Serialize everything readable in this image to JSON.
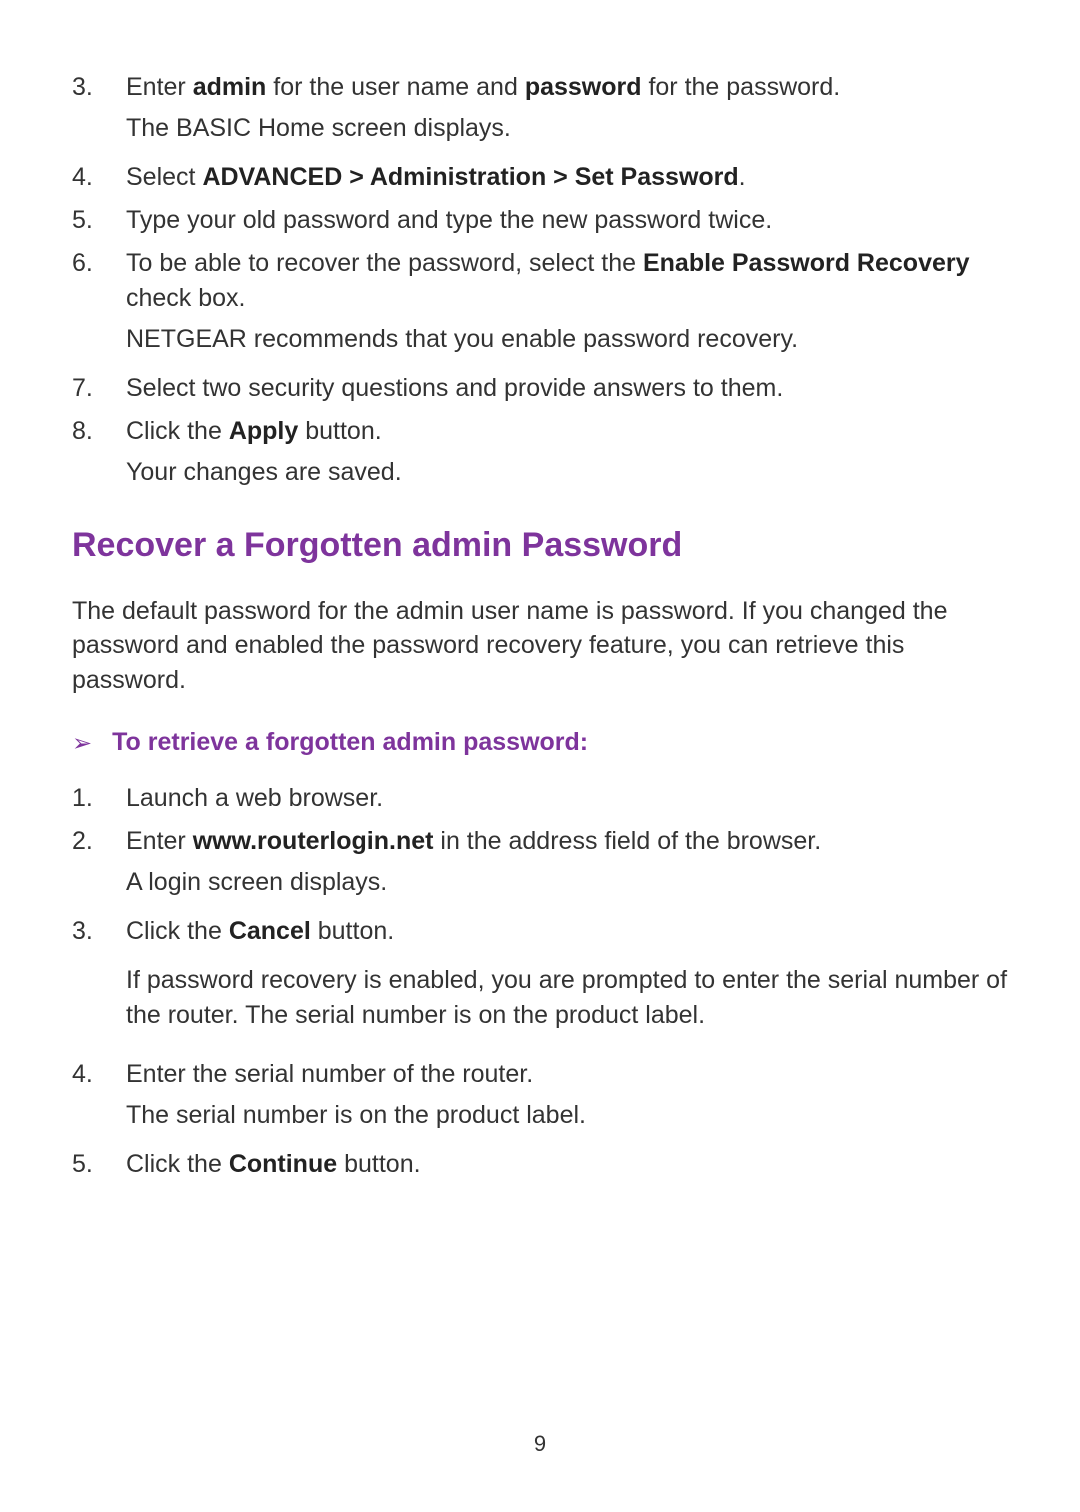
{
  "upperList": {
    "item3": {
      "num": "3.",
      "segs": [
        "Enter ",
        "admin",
        " for the user name and ",
        "password",
        " for the password."
      ],
      "sub": "The BASIC Home screen displays."
    },
    "item4": {
      "num": "4.",
      "segs": [
        "Select ",
        "ADVANCED > Administration > Set Password",
        "."
      ]
    },
    "item5": {
      "num": "5.",
      "text": "Type your old password and type the new password twice."
    },
    "item6": {
      "num": "6.",
      "segs": [
        "To be able to recover the password, select the ",
        "Enable Password Recovery",
        " check box."
      ],
      "sub": "NETGEAR recommends that you enable password recovery."
    },
    "item7": {
      "num": "7.",
      "text": "Select two security questions and provide answers to them."
    },
    "item8": {
      "num": "8.",
      "segs": [
        "Click the ",
        "Apply",
        " button."
      ],
      "sub": "Your changes are saved."
    }
  },
  "heading": "Recover a Forgotten admin Password",
  "intro": "The default password for the admin user name is password. If you changed the password and enabled the password recovery feature, you can retrieve this password.",
  "arrowSymbol": "➢",
  "subHeading": "To retrieve a forgotten admin password:",
  "lowerList": {
    "item1": {
      "num": "1.",
      "text": "Launch a web browser."
    },
    "item2": {
      "num": "2.",
      "segs": [
        "Enter ",
        "www.routerlogin.net",
        " in the address field of the browser."
      ],
      "sub": "A login screen displays."
    },
    "item3": {
      "num": "3.",
      "segs": [
        "Click the ",
        "Cancel",
        " button."
      ],
      "sub": "If password recovery is enabled, you are prompted to enter the serial number of the router. The serial number is on the product label."
    },
    "item4": {
      "num": "4.",
      "text": "Enter the serial number of the router.",
      "sub": "The serial number is on the product label."
    },
    "item5": {
      "num": "5.",
      "segs": [
        "Click the ",
        "Continue",
        " button."
      ]
    }
  },
  "pageNumber": "9"
}
